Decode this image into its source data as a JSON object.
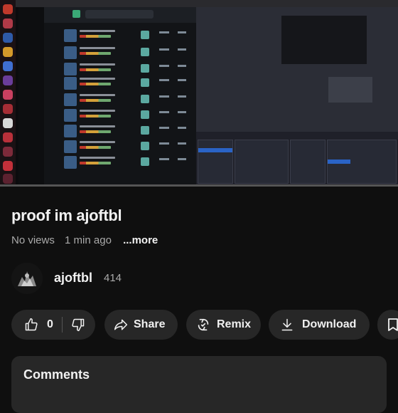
{
  "video": {
    "title": "proof im ajoftbl",
    "views": "No views",
    "age": "1 min ago",
    "more_label": "...more"
  },
  "channel": {
    "name": "ajoftbl",
    "subscribers": "414"
  },
  "actions": {
    "like_count": "0",
    "share_label": "Share",
    "remix_label": "Remix",
    "download_label": "Download"
  },
  "comments": {
    "title": "Comments"
  },
  "icons": {
    "like": "thumbs-up-icon",
    "dislike": "thumbs-down-icon",
    "share": "share-arrow-icon",
    "remix": "remix-icon",
    "download": "download-icon",
    "save": "bookmark-icon"
  },
  "colors": {
    "background": "#0f0f0f",
    "pill": "#272727",
    "secondary_text": "#aaaaaa"
  }
}
